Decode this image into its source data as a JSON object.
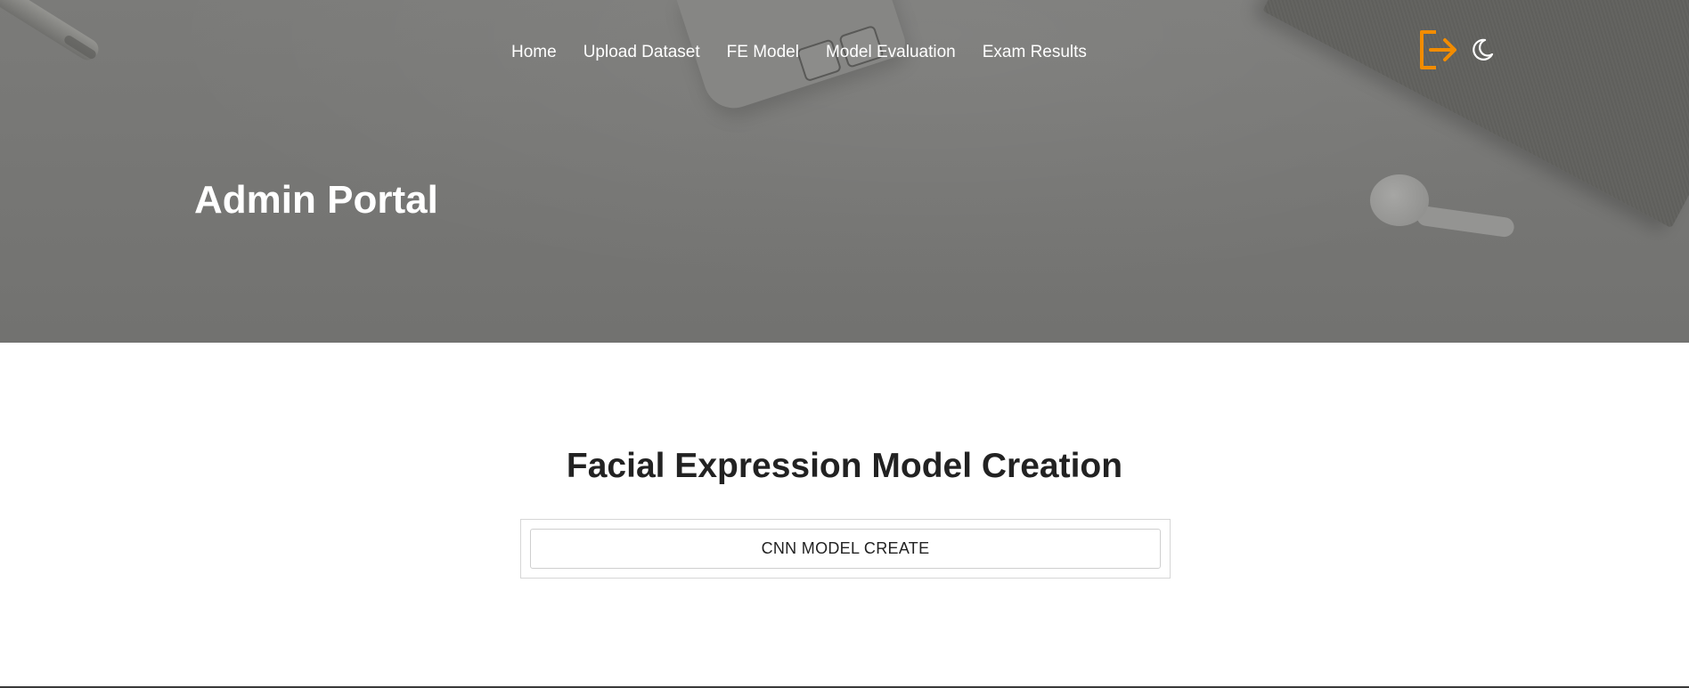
{
  "nav": {
    "items": [
      {
        "label": "Home"
      },
      {
        "label": "Upload Dataset"
      },
      {
        "label": "FE Model"
      },
      {
        "label": "Model Evaluation"
      },
      {
        "label": "Exam Results"
      }
    ],
    "logout_icon": "logout-icon",
    "theme_icon": "moon-icon"
  },
  "hero": {
    "title": "Admin Portal"
  },
  "main": {
    "heading": "Facial Expression Model Creation",
    "button_label": "CNN MODEL CREATE"
  },
  "colors": {
    "accent": "#f28c00",
    "hero_overlay": "#767674",
    "heading": "#222222"
  }
}
